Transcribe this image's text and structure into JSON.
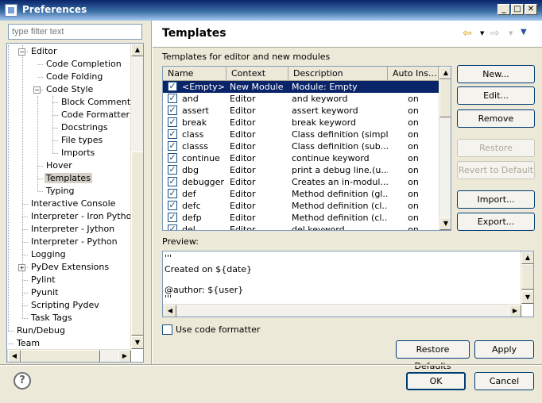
{
  "window": {
    "title": "Preferences",
    "controls": [
      "_",
      "□",
      "✕"
    ]
  },
  "filter": {
    "placeholder": "type filter text"
  },
  "tree": {
    "items": [
      {
        "label": "Editor",
        "level": 1,
        "expander": "−"
      },
      {
        "label": "Code Completion",
        "level": 2
      },
      {
        "label": "Code Folding",
        "level": 2
      },
      {
        "label": "Code Style",
        "level": 2,
        "expander": "−"
      },
      {
        "label": "Block Comments",
        "level": 3
      },
      {
        "label": "Code Formatter",
        "level": 3
      },
      {
        "label": "Docstrings",
        "level": 3
      },
      {
        "label": "File types",
        "level": 3
      },
      {
        "label": "Imports",
        "level": 3
      },
      {
        "label": "Hover",
        "level": 2
      },
      {
        "label": "Templates",
        "level": 2,
        "selected": true
      },
      {
        "label": "Typing",
        "level": 2
      },
      {
        "label": "Interactive Console",
        "level": 1
      },
      {
        "label": "Interpreter - Iron Python",
        "level": 1
      },
      {
        "label": "Interpreter - Jython",
        "level": 1
      },
      {
        "label": "Interpreter - Python",
        "level": 1
      },
      {
        "label": "Logging",
        "level": 1
      },
      {
        "label": "PyDev Extensions",
        "level": 1,
        "expander": "+"
      },
      {
        "label": "Pylint",
        "level": 1
      },
      {
        "label": "Pyunit",
        "level": 1
      },
      {
        "label": "Scripting Pydev",
        "level": 1
      },
      {
        "label": "Task Tags",
        "level": 1
      },
      {
        "label": "Run/Debug",
        "level": 0
      },
      {
        "label": "Team",
        "level": 0
      }
    ]
  },
  "header": {
    "title": "Templates",
    "back_arrow": "⇦",
    "forward_arrow": "⇨",
    "menu_arrow": "▼"
  },
  "section_label": "Templates for editor and new modules",
  "table": {
    "columns": [
      "Name",
      "Context",
      "Description",
      "Auto Ins..."
    ],
    "rows": [
      {
        "name": "<Empty>",
        "context": "New Module",
        "description": "Module: Empty",
        "auto": "",
        "checked": true,
        "selected": true
      },
      {
        "name": "and",
        "context": "Editor",
        "description": "and keyword",
        "auto": "on",
        "checked": true
      },
      {
        "name": "assert",
        "context": "Editor",
        "description": "assert keyword",
        "auto": "on",
        "checked": true
      },
      {
        "name": "break",
        "context": "Editor",
        "description": "break keyword",
        "auto": "on",
        "checked": true
      },
      {
        "name": "class",
        "context": "Editor",
        "description": "Class definition (simple)",
        "auto": "on",
        "checked": true
      },
      {
        "name": "classs",
        "context": "Editor",
        "description": "Class definition (sub...",
        "auto": "on",
        "checked": true
      },
      {
        "name": "continue",
        "context": "Editor",
        "description": "continue keyword",
        "auto": "on",
        "checked": true
      },
      {
        "name": "dbg",
        "context": "Editor",
        "description": "print a debug line.(u...",
        "auto": "on",
        "checked": true
      },
      {
        "name": "debugger",
        "context": "Editor",
        "description": "Creates an in-modul...",
        "auto": "on",
        "checked": true
      },
      {
        "name": "def",
        "context": "Editor",
        "description": "Method definition (gl...",
        "auto": "on",
        "checked": true
      },
      {
        "name": "defc",
        "context": "Editor",
        "description": "Method definition (cl...",
        "auto": "on",
        "checked": true
      },
      {
        "name": "defp",
        "context": "Editor",
        "description": "Method definition (cl...",
        "auto": "on",
        "checked": true
      },
      {
        "name": "del",
        "context": "Editor",
        "description": "del keyword",
        "auto": "on",
        "checked": true
      }
    ]
  },
  "side_buttons": {
    "new": "New...",
    "edit": "Edit...",
    "remove": "Remove",
    "restore_removed": "Restore Removed",
    "revert_default": "Revert to Default",
    "import": "Import...",
    "export": "Export..."
  },
  "preview": {
    "label": "Preview:",
    "lines": [
      "'''",
      "Created on ${date}",
      "",
      "@author: ${user}",
      "'''"
    ]
  },
  "use_code_formatter": {
    "label": "Use code formatter",
    "checked": false
  },
  "buttons": {
    "restore_defaults": "Restore Defaults",
    "apply": "Apply",
    "ok": "OK",
    "cancel": "Cancel"
  },
  "help_icon_glyph": "?"
}
